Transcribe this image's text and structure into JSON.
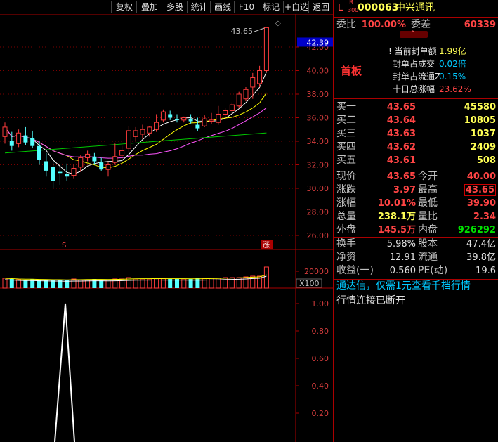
{
  "toolbar": {
    "items": [
      "复权",
      "叠加",
      "多股",
      "统计",
      "画线",
      "F10",
      "标记",
      "+自选",
      "返回"
    ]
  },
  "chart": {
    "price_ticks": [
      "42.00",
      "40.00",
      "38.00",
      "36.00",
      "34.00",
      "32.00",
      "30.00",
      "28.00",
      "26.00"
    ],
    "current_price_tag": "42.39",
    "max_annotation": "43.65",
    "volume_tick": "20000",
    "volume_unit": "X100",
    "indicator_ticks": [
      "1.00",
      "0.80",
      "0.60",
      "0.40",
      "0.20"
    ],
    "marker_s": "S",
    "marker_zhang": "涨"
  },
  "chart_data": {
    "type": "candlestick",
    "series": [
      {
        "name": "K",
        "values": [
          {
            "o": 34.4,
            "h": 35.6,
            "l": 33.8,
            "c": 35.2
          },
          {
            "o": 34.0,
            "h": 34.8,
            "l": 33.2,
            "c": 33.6
          },
          {
            "o": 33.8,
            "h": 35.0,
            "l": 33.5,
            "c": 34.7
          },
          {
            "o": 34.5,
            "h": 35.2,
            "l": 33.7,
            "c": 33.9
          },
          {
            "o": 34.3,
            "h": 34.9,
            "l": 33.4,
            "c": 33.6
          },
          {
            "o": 33.6,
            "h": 34.0,
            "l": 32.0,
            "c": 32.4
          },
          {
            "o": 32.3,
            "h": 33.0,
            "l": 31.0,
            "c": 31.5
          },
          {
            "o": 31.8,
            "h": 32.3,
            "l": 30.0,
            "c": 30.6
          },
          {
            "o": 31.4,
            "h": 32.0,
            "l": 30.3,
            "c": 31.3
          },
          {
            "o": 31.2,
            "h": 32.1,
            "l": 30.6,
            "c": 31.0
          },
          {
            "o": 31.1,
            "h": 32.0,
            "l": 30.8,
            "c": 31.7
          },
          {
            "o": 31.8,
            "h": 32.8,
            "l": 31.4,
            "c": 32.6
          },
          {
            "o": 32.6,
            "h": 33.2,
            "l": 32.3,
            "c": 32.9
          },
          {
            "o": 32.7,
            "h": 33.0,
            "l": 32.0,
            "c": 32.3
          },
          {
            "o": 32.2,
            "h": 32.6,
            "l": 31.5,
            "c": 31.6
          },
          {
            "o": 31.6,
            "h": 32.2,
            "l": 31.0,
            "c": 32.0
          },
          {
            "o": 32.2,
            "h": 33.8,
            "l": 32.0,
            "c": 32.7
          },
          {
            "o": 32.8,
            "h": 33.6,
            "l": 32.4,
            "c": 33.2
          },
          {
            "o": 33.4,
            "h": 35.3,
            "l": 33.1,
            "c": 34.9
          },
          {
            "o": 34.4,
            "h": 35.2,
            "l": 34.0,
            "c": 34.9
          },
          {
            "o": 34.6,
            "h": 35.4,
            "l": 34.2,
            "c": 35.0
          },
          {
            "o": 34.7,
            "h": 35.3,
            "l": 34.4,
            "c": 35.2
          },
          {
            "o": 35.0,
            "h": 36.3,
            "l": 34.8,
            "c": 35.6
          },
          {
            "o": 35.8,
            "h": 36.7,
            "l": 35.6,
            "c": 36.5
          },
          {
            "o": 36.3,
            "h": 36.6,
            "l": 35.8,
            "c": 36.0
          },
          {
            "o": 35.9,
            "h": 36.3,
            "l": 35.6,
            "c": 35.8
          },
          {
            "o": 35.8,
            "h": 36.1,
            "l": 35.6,
            "c": 36.0
          },
          {
            "o": 35.9,
            "h": 36.3,
            "l": 35.5,
            "c": 35.7
          },
          {
            "o": 35.4,
            "h": 36.0,
            "l": 34.9,
            "c": 35.1
          },
          {
            "o": 35.3,
            "h": 36.2,
            "l": 35.2,
            "c": 35.9
          },
          {
            "o": 35.7,
            "h": 36.4,
            "l": 35.5,
            "c": 35.8
          },
          {
            "o": 35.6,
            "h": 37.0,
            "l": 35.4,
            "c": 36.3
          },
          {
            "o": 36.3,
            "h": 36.8,
            "l": 35.9,
            "c": 36.6
          },
          {
            "o": 36.6,
            "h": 37.3,
            "l": 36.3,
            "c": 37.1
          },
          {
            "o": 37.0,
            "h": 38.2,
            "l": 36.8,
            "c": 38.0
          },
          {
            "o": 37.6,
            "h": 38.6,
            "l": 37.4,
            "c": 38.4
          },
          {
            "o": 38.6,
            "h": 39.8,
            "l": 37.6,
            "c": 39.4
          },
          {
            "o": 38.9,
            "h": 40.4,
            "l": 38.6,
            "c": 40.0
          },
          {
            "o": 40.0,
            "h": 43.65,
            "l": 39.9,
            "c": 43.65
          }
        ]
      }
    ],
    "ylim": [
      26,
      42.6
    ]
  },
  "panel": {
    "header": {
      "l": "L",
      "r": "R",
      "code300": "300",
      "code": "000063",
      "name": "中兴通讯"
    },
    "weibi": {
      "label": "委比",
      "value": "100.00%",
      "cha_label": "委差",
      "cha_value": "60339"
    },
    "shouban": "首板",
    "info": [
      {
        "label": "当前封单额",
        "value": "1.99亿",
        "color": "#ffff55"
      },
      {
        "label": "封单占成交",
        "value": "0.02倍",
        "color": "#00c8ff"
      },
      {
        "label": "封单占流通Z",
        "value": "0.15%",
        "color": "#00c8ff"
      },
      {
        "label": "十日总涨幅",
        "value": "23.62%",
        "color": "#ff4444"
      }
    ],
    "buys": [
      {
        "label": "买一",
        "price": "43.65",
        "vol": "45580"
      },
      {
        "label": "买二",
        "price": "43.64",
        "vol": "10805"
      },
      {
        "label": "买三",
        "price": "43.63",
        "vol": "1037"
      },
      {
        "label": "买四",
        "price": "43.62",
        "vol": "2409"
      },
      {
        "label": "买五",
        "price": "43.61",
        "vol": "508"
      }
    ],
    "quotes": [
      {
        "l1": "现价",
        "v1": "43.65",
        "c1": "red",
        "l2": "今开",
        "v2": "40.00",
        "c2": "red"
      },
      {
        "l1": "涨跌",
        "v1": "3.97",
        "c1": "red",
        "l2": "最高",
        "v2": "43.65",
        "c2": "red"
      },
      {
        "l1": "涨幅",
        "v1": "10.01%",
        "c1": "red",
        "l2": "最低",
        "v2": "39.90",
        "c2": "red"
      },
      {
        "l1": "总量",
        "v1": "238.1万",
        "c1": "yel",
        "l2": "量比",
        "v2": "2.34",
        "c2": "red"
      },
      {
        "l1": "外盘",
        "v1": "145.5万",
        "c1": "red",
        "l2": "内盘",
        "v2": "926292",
        "c2": "grn"
      }
    ],
    "stats": [
      {
        "l1": "换手",
        "v1": "5.98%",
        "l2": "股本",
        "v2": "47.4亿"
      },
      {
        "l1": "净资",
        "v1": "12.91",
        "l2": "流通",
        "v2": "39.8亿"
      },
      {
        "l1": "收益(一)",
        "v1": "0.560",
        "l2": "PE(动)",
        "v2": "19.6"
      }
    ],
    "ad": "通达信，仅需1元查看千档行情",
    "status": "行情连接已断开"
  },
  "colors": {
    "up": "#ff3c3c",
    "down": "#54ffff",
    "ma5": "#ffffff",
    "ma10": "#ffff00",
    "ma20": "#ff55ff",
    "ma60": "#00c800"
  }
}
